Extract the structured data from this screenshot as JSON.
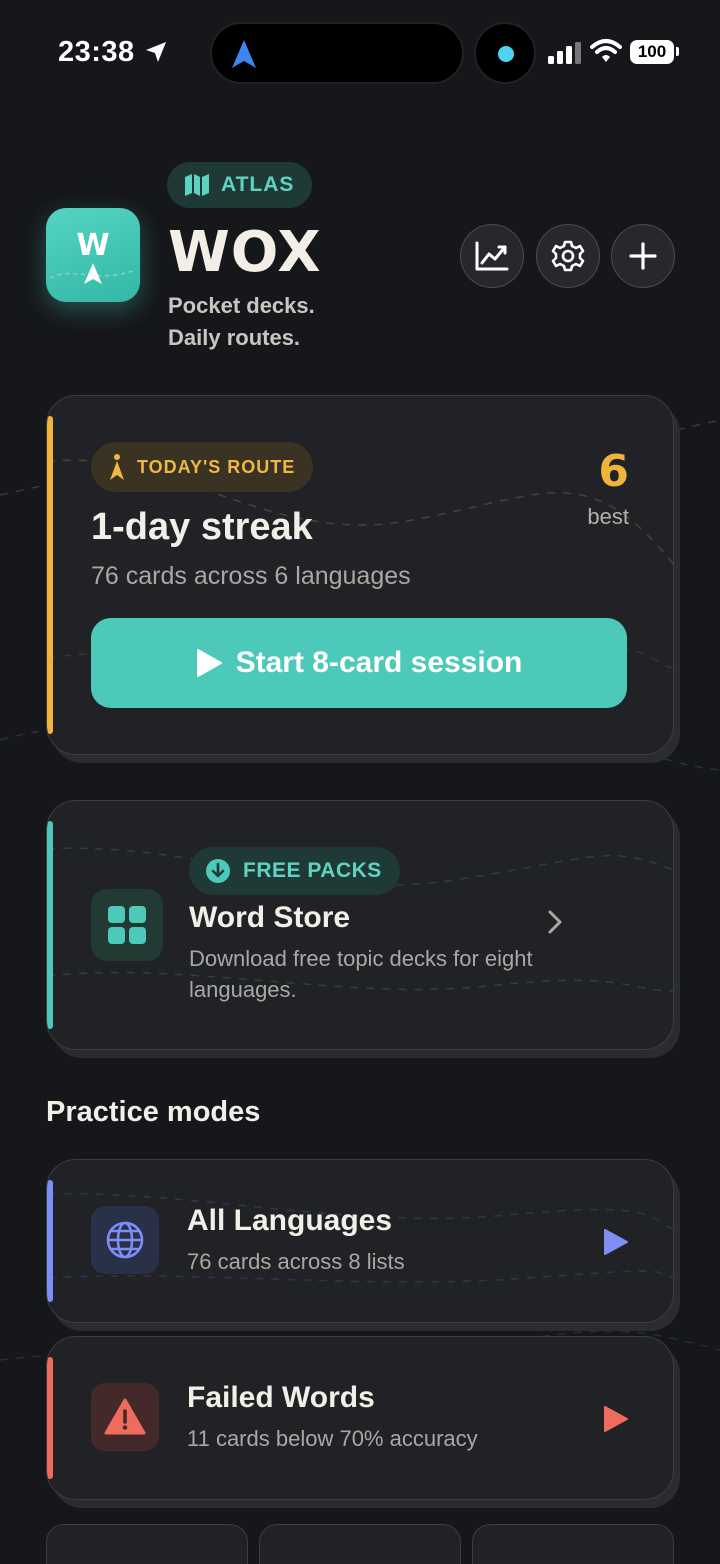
{
  "status_bar": {
    "time": "23:38",
    "battery": "100"
  },
  "header": {
    "atlas_label": "ATLAS",
    "app_name": "WOX",
    "icon_letter": "W",
    "tagline_line1": "Pocket decks.",
    "tagline_line2": "Daily routes."
  },
  "streak_card": {
    "badge": "TODAY'S ROUTE",
    "title": "1-day streak",
    "subtitle": "76 cards across 6 languages",
    "best_value": "6",
    "best_label": "best",
    "start_label": "Start 8-card session"
  },
  "store_card": {
    "badge": "FREE PACKS",
    "title": "Word Store",
    "description": "Download free topic decks for eight languages."
  },
  "practice": {
    "section_title": "Practice modes",
    "modes": [
      {
        "title": "All Languages",
        "subtitle": "76 cards across 8 lists",
        "accent": "#7d8ff5",
        "icon": "globe-icon"
      },
      {
        "title": "Failed Words",
        "subtitle": "11 cards below 70% accuracy",
        "accent": "#ee6b5e",
        "icon": "warning-icon"
      }
    ]
  },
  "colors": {
    "background": "#15171a",
    "card": "#202225",
    "teal": "#4cc9b9",
    "gold": "#f0b43a",
    "blue": "#7d8ff5",
    "red": "#ee6b5e"
  }
}
